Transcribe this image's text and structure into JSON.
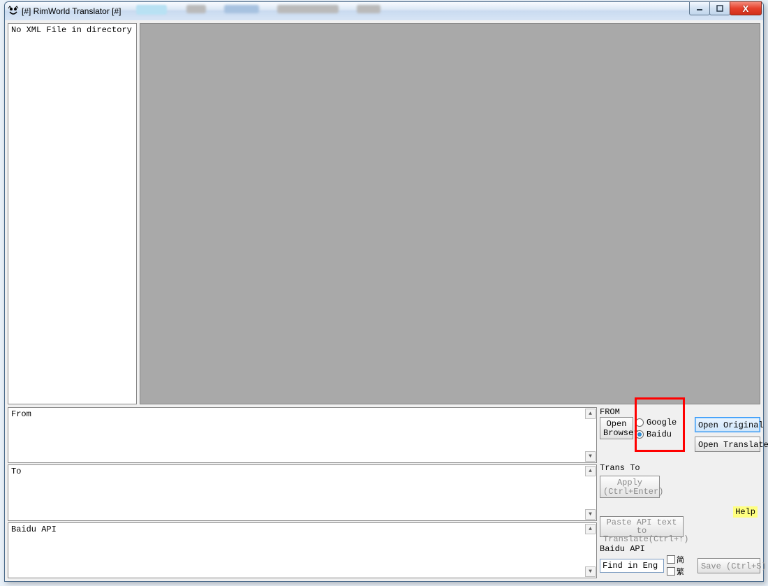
{
  "titlebar": {
    "title": "[#] RimWorld Translator [#]"
  },
  "filelist": {
    "message": "No XML File in directory"
  },
  "panels": {
    "from_label": "From",
    "to_label": "To",
    "baiduapi_label": "Baidu API"
  },
  "right": {
    "from_label": "FROM",
    "open_browser": "Open\nBrowser",
    "radios": {
      "google": "Google",
      "baidu": "Baidu"
    },
    "trans_to_label": "Trans To",
    "apply_label": "Apply\n(Ctrl+Enter)",
    "paste_api_label": "Paste API text to\nTranslate(Ctrl+↑)",
    "baidu_api_label": "Baidu API",
    "find_placeholder": "Find in Eng",
    "jian_label": "简",
    "fan_label": "繁",
    "open_original": "Open Original",
    "open_translated": "Open Translated",
    "help_label": "Help",
    "save_label": "Save (Ctrl+S)"
  }
}
